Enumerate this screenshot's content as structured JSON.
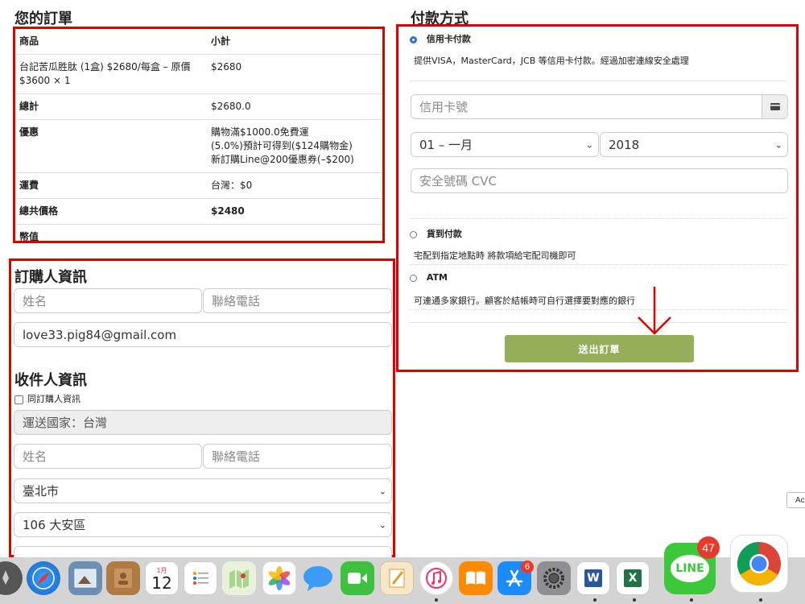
{
  "order": {
    "title": "您的訂單",
    "header": {
      "product": "商品",
      "subtotal": "小計"
    },
    "item": {
      "line1": "台記苦瓜胜肽 (1盒) $2680/每盒 – 原價",
      "line2": "$3600 × 1",
      "subtotal": "$2680"
    },
    "total": {
      "label": "總計",
      "value": "$2680.0"
    },
    "discount": {
      "label": "優惠",
      "line1": "購物滿$1000.0免費運",
      "line2": "(5.0%)預計可得到($124購物金)",
      "line3": "新訂購Line@200優惠券(–$200)"
    },
    "shipping": {
      "label": "運費",
      "value": "台灣：$0"
    },
    "grand_total": {
      "label": "總共價格",
      "value": "$2480"
    },
    "currency": {
      "label": "幣值",
      "value": ""
    }
  },
  "buyer": {
    "title": "訂購人資訊",
    "name_placeholder": "姓名",
    "phone_placeholder": "聯絡電話",
    "email_value": "love33.pig84@gmail.com"
  },
  "recipient": {
    "title": "收件人資訊",
    "same_as_buyer": "同訂購人資訊",
    "country": "運送國家：台灣",
    "name_placeholder": "姓名",
    "phone_placeholder": "聯絡電話",
    "city": "臺北市",
    "district": "106 大安區"
  },
  "payment": {
    "title": "付款方式",
    "credit": {
      "label": "信用卡付款",
      "desc": "提供VISA，MasterCard，JCB 等信用卡付款。經過加密連線安全處理"
    },
    "card_placeholder": "信用卡號",
    "month": "01 – 一月",
    "year": "2018",
    "cvc_placeholder": "安全號碼 CVC",
    "cod": {
      "label": "貨到付款",
      "desc": "宅配到指定地點時 將款項給宅配司機即可"
    },
    "atm": {
      "label": "ATM",
      "desc": "可連通多家銀行。顧客於結帳時可自行選擇要對應的銀行"
    },
    "submit": "送出訂單"
  },
  "dock": {
    "calendar_month": "1月",
    "calendar_day": "12",
    "appstore_badge": "6",
    "line_badge": "47",
    "line_label": "LINE",
    "word_letter": "W",
    "excel_letter": "X"
  },
  "edge_tab": "Ac",
  "colors": {
    "accent_red": "#e00000",
    "submit_green": "#94ae5a",
    "radio_blue": "#2872d9"
  }
}
